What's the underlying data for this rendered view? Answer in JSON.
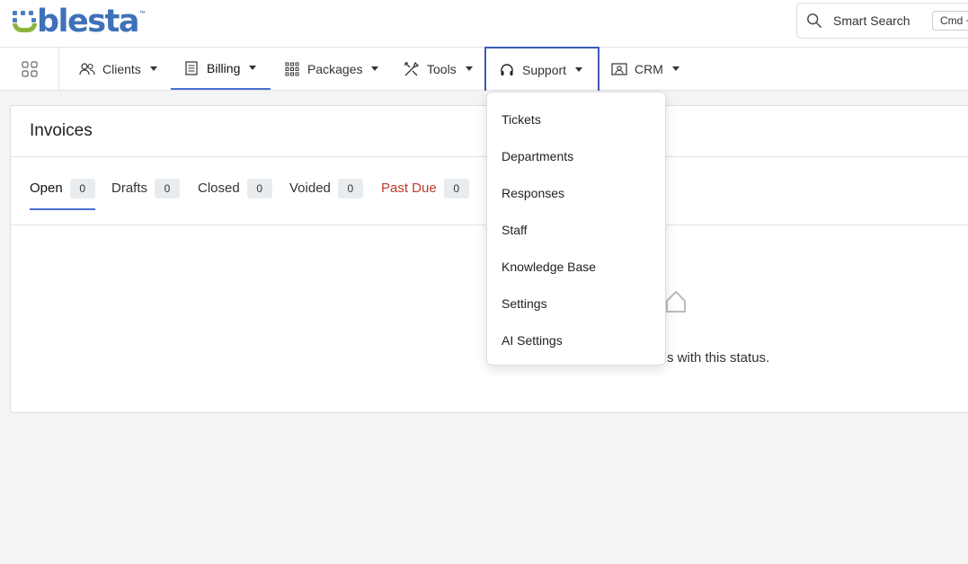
{
  "header": {
    "logo_text": "blesta",
    "logo_tm": "™",
    "search_label": "Smart Search",
    "search_shortcut": "Cmd + K"
  },
  "nav": {
    "items": [
      {
        "label": "Clients",
        "icon": "users-icon"
      },
      {
        "label": "Billing",
        "icon": "invoice-icon"
      },
      {
        "label": "Packages",
        "icon": "grid-dots-icon"
      },
      {
        "label": "Tools",
        "icon": "tools-icon"
      },
      {
        "label": "Support",
        "icon": "headset-icon"
      },
      {
        "label": "CRM",
        "icon": "contact-card-icon"
      }
    ],
    "active": "Billing",
    "open": "Support"
  },
  "support_menu": {
    "items": [
      "Tickets",
      "Departments",
      "Responses",
      "Staff",
      "Knowledge Base",
      "Settings",
      "AI Settings"
    ]
  },
  "invoices": {
    "title": "Invoices",
    "tabs": [
      {
        "label": "Open",
        "count": "0"
      },
      {
        "label": "Drafts",
        "count": "0"
      },
      {
        "label": "Closed",
        "count": "0"
      },
      {
        "label": "Voided",
        "count": "0"
      },
      {
        "label": "Past Due",
        "count": "0"
      }
    ],
    "empty_text": "s with this status."
  },
  "colors": {
    "accent": "#4a6fd0",
    "danger": "#c0392b",
    "logo_blue": "#3e71b8",
    "logo_green": "#8cb43c"
  }
}
